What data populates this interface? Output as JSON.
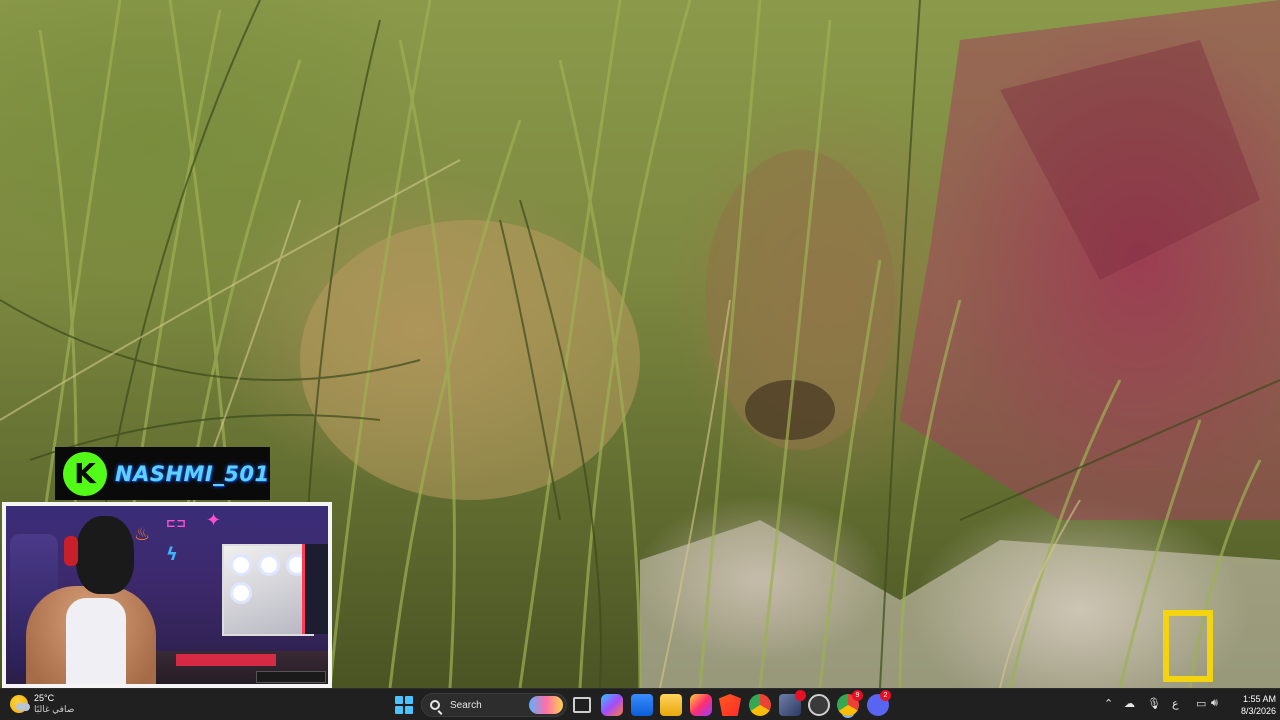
{
  "overlay": {
    "streamer_name": "NASHMI_501",
    "platform_logo_letter": "K",
    "brand_color": "#53fc18",
    "name_color": "#5fd0ff"
  },
  "taskbar": {
    "weather": {
      "temperature": "25°C",
      "condition": "صافي غالبًا",
      "icon": "partly-sunny-icon"
    },
    "search_placeholder": "Search",
    "apps": [
      {
        "name": "task-view-icon"
      },
      {
        "name": "copilot-icon"
      },
      {
        "name": "microsoft-store-icon"
      },
      {
        "name": "file-explorer-icon"
      },
      {
        "name": "instagram-icon"
      },
      {
        "name": "brave-browser-icon"
      },
      {
        "name": "chrome-icon"
      },
      {
        "name": "app-icon",
        "badge": ""
      },
      {
        "name": "app-icon-2"
      },
      {
        "name": "chrome-active-icon",
        "badge": "9"
      },
      {
        "name": "discord-icon",
        "badge": "2"
      }
    ],
    "tray": {
      "keyboard_layout": "ع",
      "time": "1:55 AM",
      "date": "8/3/2026"
    }
  }
}
